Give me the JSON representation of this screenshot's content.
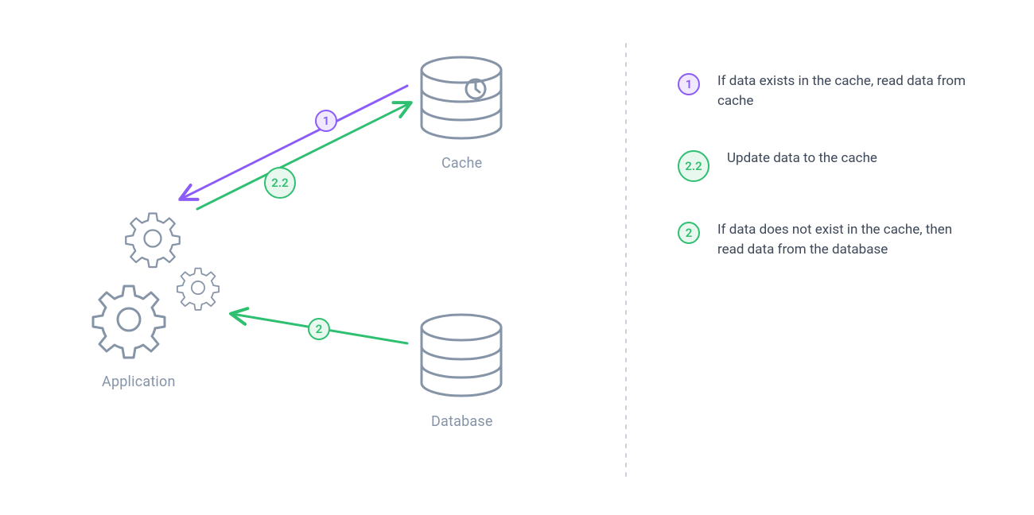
{
  "nodes": {
    "application": {
      "label": "Application"
    },
    "cache": {
      "label": "Cache"
    },
    "database": {
      "label": "Database"
    }
  },
  "arrows": {
    "step1": {
      "number": "1",
      "color": "purple"
    },
    "step2_2": {
      "number": "2.2",
      "color": "green"
    },
    "step2": {
      "number": "2",
      "color": "green"
    }
  },
  "legend": [
    {
      "badge": "1",
      "style": "purple",
      "text": "If data exists in the cache, read data from cache"
    },
    {
      "badge": "2.2",
      "style": "green-large",
      "text": "Update data to the cache"
    },
    {
      "badge": "2",
      "style": "green-small",
      "text": "If data does not exist in the cache, then read data from the database"
    }
  ],
  "colors": {
    "outline": "#8694a7",
    "purple": "#8b5cf6",
    "green": "#2fbf71",
    "text": "#3d4859"
  }
}
